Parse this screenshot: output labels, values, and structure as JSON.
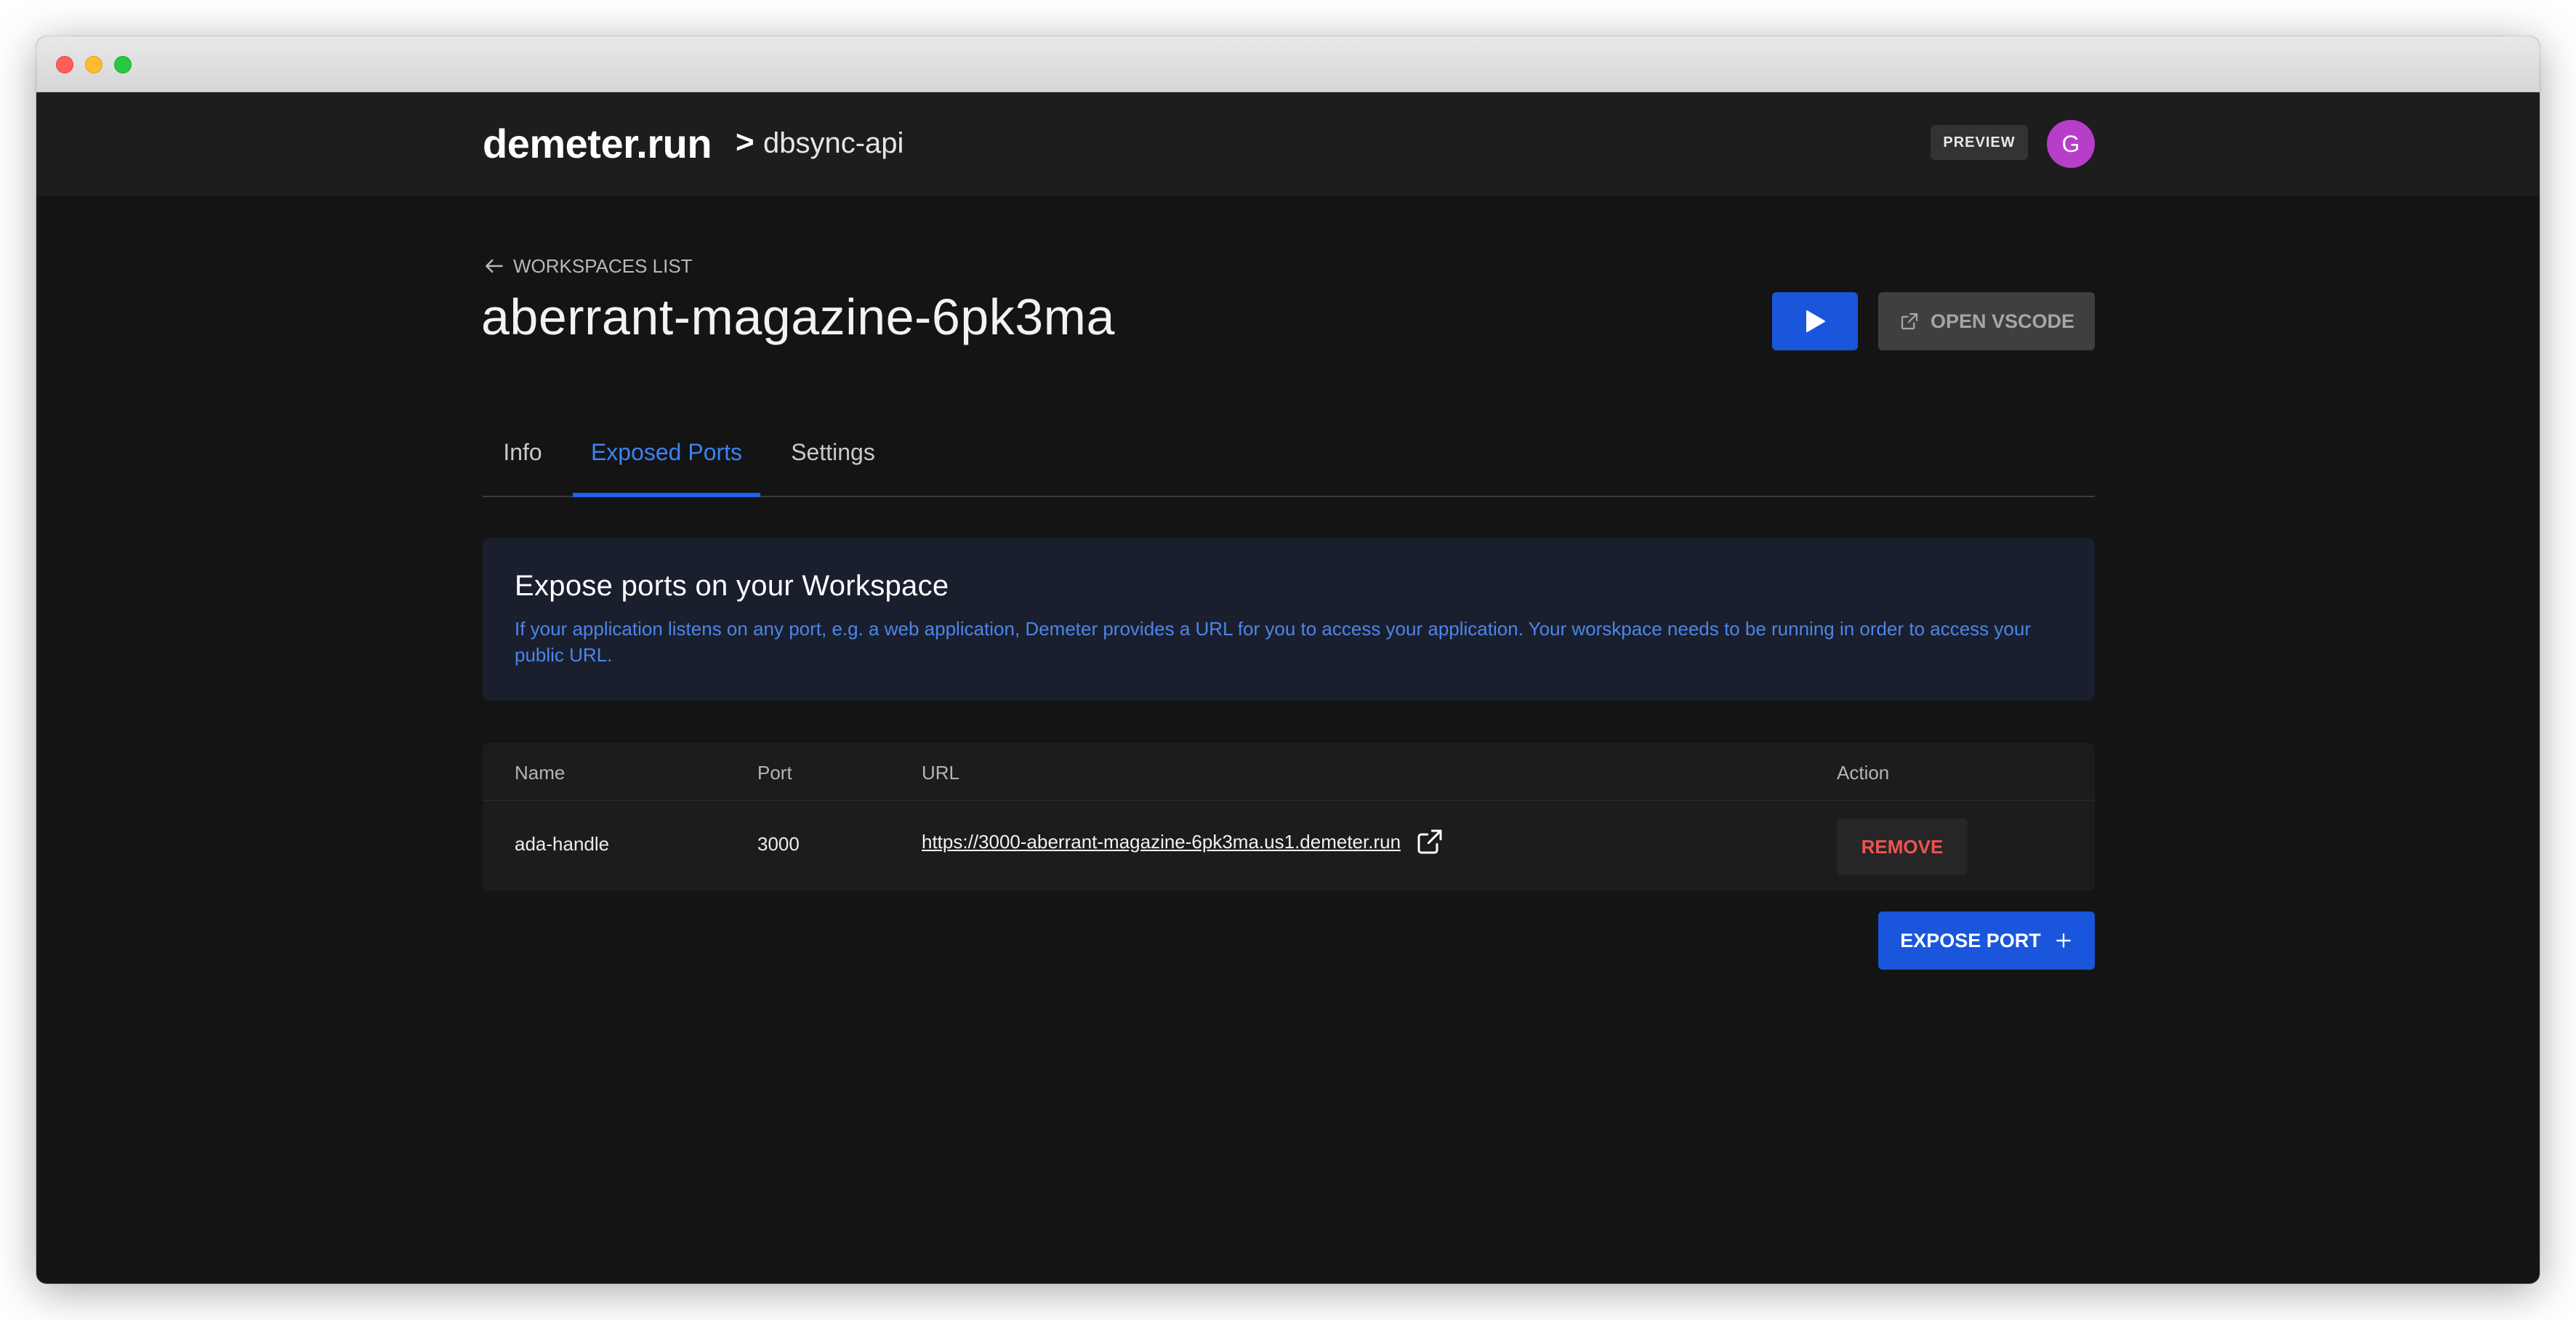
{
  "header": {
    "brand": "demeter.run",
    "breadcrumb_separator": ">",
    "project": "dbsync-api",
    "preview_badge": "PREVIEW",
    "avatar_initial": "G"
  },
  "workspace": {
    "back_link": "WORKSPACES LIST",
    "title": "aberrant-magazine-6pk3ma",
    "open_vscode_label": "OPEN VSCODE"
  },
  "tabs": [
    {
      "label": "Info",
      "active": false
    },
    {
      "label": "Exposed Ports",
      "active": true
    },
    {
      "label": "Settings",
      "active": false
    }
  ],
  "info_box": {
    "title": "Expose ports on your Workspace",
    "description": "If your application listens on any port, e.g. a web application, Demeter provides a URL for you to access your application. Your worskpace needs to be running in order to access your public URL."
  },
  "ports_table": {
    "columns": [
      "Name",
      "Port",
      "URL",
      "Action"
    ],
    "rows": [
      {
        "name": "ada-handle",
        "port": "3000",
        "url": "https://3000-aberrant-magazine-6pk3ma.us1.demeter.run",
        "action": "REMOVE"
      }
    ]
  },
  "expose_port_label": "EXPOSE PORT",
  "colors": {
    "accent": "#1a56db",
    "active_tab": "#3b82f6",
    "danger": "#f05252",
    "avatar": "#b63ec9",
    "background": "#141414"
  },
  "icons": [
    "arrow-left-icon",
    "play-icon",
    "external-link-icon",
    "plus-icon"
  ]
}
